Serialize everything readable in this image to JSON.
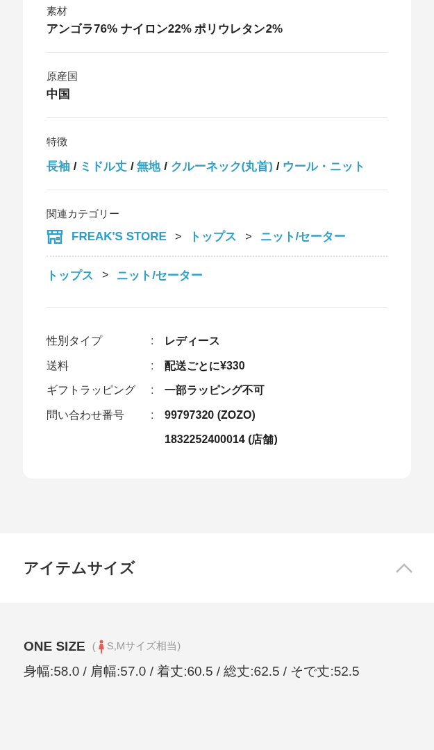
{
  "details": [
    {
      "label": "素材",
      "value": "アンゴラ76% ナイロン22% ポリウレタン2%"
    },
    {
      "label": "原産国",
      "value": "中国"
    }
  ],
  "features": {
    "label": "特徴",
    "separator": "/",
    "items": [
      "長袖",
      "ミドル丈",
      "無地",
      "クルーネック(丸首)",
      "ウール・ニット"
    ]
  },
  "categories": {
    "label": "関連カテゴリー",
    "paths": [
      {
        "kind": "store",
        "separator": ">",
        "crumbs": [
          "FREAK'S STORE",
          "トップス",
          "ニット/セーター"
        ]
      },
      {
        "kind": "plain",
        "separator": ">",
        "crumbs": [
          "トップス",
          "ニット/セーター"
        ]
      }
    ]
  },
  "info": [
    {
      "label": "性別タイプ",
      "colon": ":",
      "values": [
        "レディース"
      ]
    },
    {
      "label": "送料",
      "colon": ":",
      "values": [
        "配送ごとに¥330"
      ]
    },
    {
      "label": "ギフトラッピング",
      "colon": ":",
      "values": [
        "一部ラッピング不可"
      ]
    },
    {
      "label": "問い合わせ番号",
      "colon": ":",
      "values": [
        "99797320 (ZOZO)",
        "1832252400014 (店舗)"
      ]
    }
  ],
  "size_section": {
    "title": "アイテムサイズ",
    "expanded": true,
    "sizes": [
      {
        "name": "ONE SIZE",
        "note_open": "(",
        "note": "S,Mサイズ相当)",
        "measurements": "身幅:58.0 / 肩幅:57.0 / 着丈:60.5 / 総丈:62.5 / そで丈:52.5"
      }
    ]
  }
}
